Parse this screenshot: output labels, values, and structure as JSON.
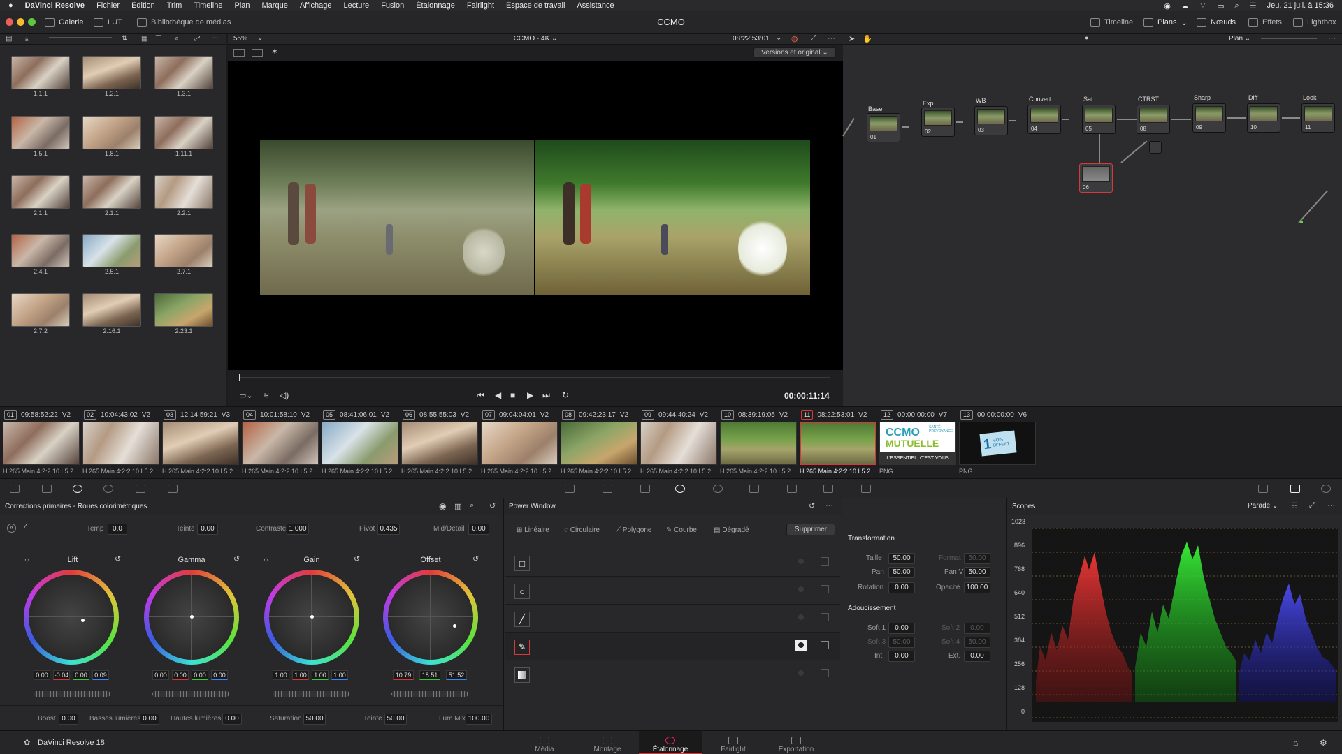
{
  "menubar": {
    "app": "DaVinci Resolve",
    "items": [
      "Fichier",
      "Édition",
      "Trim",
      "Timeline",
      "Plan",
      "Marque",
      "Affichage",
      "Lecture",
      "Fusion",
      "Étalonnage",
      "Fairlight",
      "Espace de travail",
      "Assistance"
    ],
    "clock": "Jeu. 21 juil. à 15:36"
  },
  "titlebar": {
    "title": "CCMO",
    "gallery": "Galerie",
    "lut": "LUT",
    "media": "Bibliothèque de médias",
    "timeline": "Timeline",
    "plans": "Plans",
    "nodes": "Nœuds",
    "effects": "Effets",
    "lightbox": "Lightbox"
  },
  "viewer": {
    "zoom": "55%",
    "timeline_name": "CCMO - 4K",
    "timecode_top": "08:22:53:01",
    "compare_mode": "Versions et original",
    "timecode_bottom": "00:00:11:14"
  },
  "node_editor": {
    "mode": "Plan",
    "nodes": [
      {
        "title": "Base",
        "num": "01"
      },
      {
        "title": "Exp",
        "num": "02"
      },
      {
        "title": "WB",
        "num": "03"
      },
      {
        "title": "Convert",
        "num": "04"
      },
      {
        "title": "Sat",
        "num": "05"
      },
      {
        "title": "CTRST",
        "num": "08"
      },
      {
        "title": "Sharp",
        "num": "09"
      },
      {
        "title": "Diff",
        "num": "10"
      },
      {
        "title": "Look",
        "num": "11"
      },
      {
        "title": "",
        "num": "06"
      }
    ]
  },
  "gallery": {
    "stills": [
      "1.1.1",
      "1.2.1",
      "1.3.1",
      "1.5.1",
      "1.8.1",
      "1.11.1",
      "2.1.1",
      "2.1.1",
      "2.2.1",
      "2.4.1",
      "2.5.1",
      "2.7.1",
      "2.7.2",
      "2.16.1",
      "2.23.1"
    ]
  },
  "clips": [
    {
      "num": "01",
      "tc": "09:58:52:22",
      "track": "V2",
      "caption": "H.265 Main 4:2:2 10 L5.2"
    },
    {
      "num": "02",
      "tc": "10:04:43:02",
      "track": "V2",
      "caption": "H.265 Main 4:2:2 10 L5.2"
    },
    {
      "num": "03",
      "tc": "12:14:59:21",
      "track": "V3",
      "caption": "H.265 Main 4:2:2 10 L5.2"
    },
    {
      "num": "04",
      "tc": "10:01:58:10",
      "track": "V2",
      "caption": "H.265 Main 4:2:2 10 L5.2"
    },
    {
      "num": "05",
      "tc": "08:41:06:01",
      "track": "V2",
      "caption": "H.265 Main 4:2:2 10 L5.2"
    },
    {
      "num": "06",
      "tc": "08:55:55:03",
      "track": "V2",
      "caption": "H.265 Main 4:2:2 10 L5.2"
    },
    {
      "num": "07",
      "tc": "09:04:04:01",
      "track": "V2",
      "caption": "H.265 Main 4:2:2 10 L5.2"
    },
    {
      "num": "08",
      "tc": "09:42:23:17",
      "track": "V2",
      "caption": "H.265 Main 4:2:2 10 L5.2"
    },
    {
      "num": "09",
      "tc": "09:44:40:24",
      "track": "V2",
      "caption": "H.265 Main 4:2:2 10 L5.2"
    },
    {
      "num": "10",
      "tc": "08:39:19:05",
      "track": "V2",
      "caption": "H.265 Main 4:2:2 10 L5.2"
    },
    {
      "num": "11",
      "tc": "08:22:53:01",
      "track": "V2",
      "caption": "H.265 Main 4:2:2 10 L5.2"
    },
    {
      "num": "12",
      "tc": "00:00:00:00",
      "track": "V7",
      "caption": "PNG"
    },
    {
      "num": "13",
      "tc": "00:00:00:00",
      "track": "V6",
      "caption": "PNG"
    }
  ],
  "clip_graphics": {
    "ccmo_logo": "CCMO",
    "ccmo_sub": "MUTUELLE",
    "ccmo_tag": "SANTÉ PRÉVOYANCE",
    "ccmo_slogan": "L'ESSENTIEL, C'EST VOUS.",
    "promo_1": "1",
    "promo_2": "MOIS",
    "promo_3": "OFFERT"
  },
  "primaries": {
    "title": "Corrections primaires - Roues colorimétriques",
    "temp_label": "Temp",
    "temp": "0.0",
    "tint_label": "Teinte",
    "tint": "0.00",
    "contrast_label": "Contraste",
    "contrast": "1.000",
    "pivot_label": "Pivot",
    "pivot": "0.435",
    "middetail_label": "Mid/Détail",
    "middetail": "0.00",
    "wheels": [
      {
        "name": "Lift",
        "values": [
          "0.00",
          "-0.04",
          "0.00",
          "0.09"
        ]
      },
      {
        "name": "Gamma",
        "values": [
          "0.00",
          "0.00",
          "0.00",
          "0.00"
        ]
      },
      {
        "name": "Gain",
        "values": [
          "1.00",
          "1.00",
          "1.00",
          "1.00"
        ]
      },
      {
        "name": "Offset",
        "values": [
          "10.79",
          "18.51",
          "51.52"
        ]
      }
    ],
    "boost_label": "Boost",
    "boost": "0.00",
    "shadows_label": "Basses lumières",
    "shadows": "0.00",
    "highlights_label": "Hautes lumières",
    "highlights": "0.00",
    "saturation_label": "Saturation",
    "saturation": "50.00",
    "hue_label": "Teinte",
    "hue": "50.00",
    "lummix_label": "Lum Mix",
    "lummix": "100.00"
  },
  "power_window": {
    "title": "Power Window",
    "linear": "Linéaire",
    "circular": "Circulaire",
    "polygon": "Polygone",
    "curve": "Courbe",
    "gradient": "Dégradé",
    "delete": "Supprimer"
  },
  "transform": {
    "title": "Transformation",
    "size_label": "Taille",
    "size": "50.00",
    "format_label": "Format",
    "format": "50.00",
    "pan_label": "Pan",
    "pan": "50.00",
    "panv_label": "Pan V",
    "panv": "50.00",
    "rotation_label": "Rotation",
    "rotation": "0.00",
    "opacity_label": "Opacité",
    "opacity": "100.00",
    "soft_title": "Adoucissement",
    "soft1_label": "Soft 1",
    "soft1": "0.00",
    "soft2_label": "Soft 2",
    "soft2": "0.00",
    "soft3_label": "Soft 3",
    "soft3": "50.00",
    "soft4_label": "Soft 4",
    "soft4": "50.00",
    "int_label": "Int.",
    "int": "0.00",
    "ext_label": "Ext.",
    "ext": "0.00"
  },
  "scopes": {
    "title": "Scopes",
    "mode": "Parade",
    "ticks": [
      "1023",
      "896",
      "768",
      "640",
      "512",
      "384",
      "256",
      "128",
      "0"
    ]
  },
  "pages": {
    "product": "DaVinci Resolve 18",
    "tabs": [
      "Média",
      "Montage",
      "Étalonnage",
      "Fairlight",
      "Exportation"
    ],
    "active": "Étalonnage"
  },
  "colors": {
    "accent_red": "#d33b3b",
    "node_green": "#6bd13a",
    "node_blue": "#2e9fe0"
  }
}
